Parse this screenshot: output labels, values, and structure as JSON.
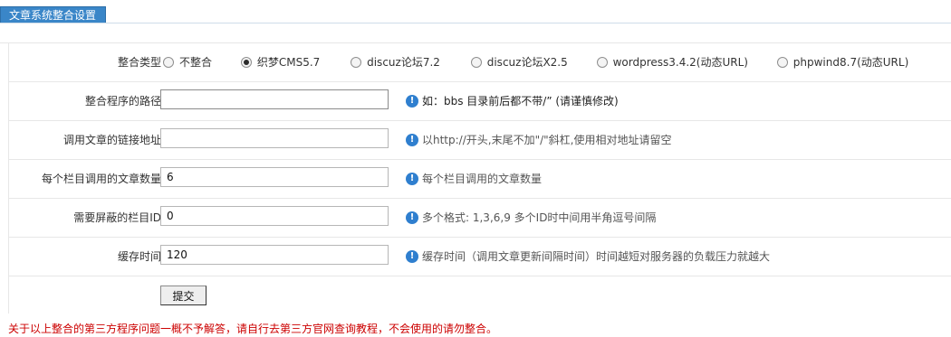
{
  "header": {
    "title": "文章系统整合设置"
  },
  "form": {
    "integration_type": {
      "label": "整合类型",
      "options": [
        {
          "label": "不整合",
          "checked": false
        },
        {
          "label": "织梦CMS5.7",
          "checked": true
        },
        {
          "label": "discuz论坛7.2",
          "checked": false
        },
        {
          "label": "discuz论坛X2.5",
          "checked": false
        },
        {
          "label": "wordpress3.4.2(动态URL)",
          "checked": false
        },
        {
          "label": "phpwind8.7(动态URL)",
          "checked": false
        }
      ]
    },
    "program_path": {
      "label": "整合程序的路径",
      "value": "",
      "hint": "如：bbs  目录前后都不带/” (请谨慎修改)"
    },
    "link_url": {
      "label": "调用文章的链接地址",
      "value": "",
      "hint": "以http://开头,末尾不加\"/\"斜杠,使用相对地址请留空"
    },
    "articles_per_column": {
      "label": "每个栏目调用的文章数量",
      "value": "6",
      "hint": "每个栏目调用的文章数量"
    },
    "blocked_column_ids": {
      "label": "需要屏蔽的栏目ID",
      "value": "0",
      "hint": "多个格式: 1,3,6,9 多个ID时中间用半角逗号间隔"
    },
    "cache_time": {
      "label": "缓存时间",
      "value": "120",
      "hint": "缓存时间（调用文章更新间隔时间）时间越短对服务器的负载压力就越大"
    },
    "submit_label": "提交"
  },
  "notice": "关于以上整合的第三方程序问题一概不予解答，请自行去第三方官网查询教程，不会使用的请勿整合。",
  "icons": {
    "info": "info-icon"
  },
  "colors": {
    "accent": "#3a86c8",
    "info_icon": "#2f7fcf",
    "notice": "#cc0000"
  }
}
